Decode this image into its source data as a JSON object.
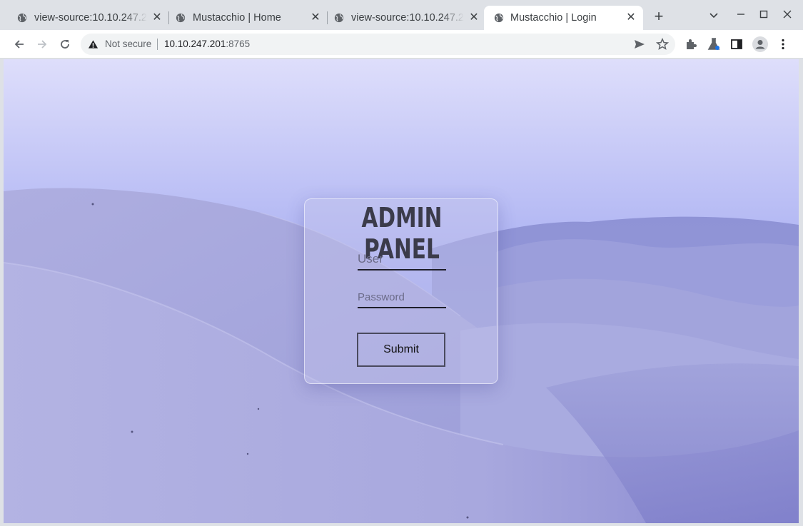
{
  "browser": {
    "tabs": [
      {
        "title": "view-source:10.10.247.2",
        "active": false
      },
      {
        "title": "Mustacchio | Home",
        "active": false
      },
      {
        "title": "view-source:10.10.247.2",
        "active": false
      },
      {
        "title": "Mustacchio | Login",
        "active": true
      }
    ],
    "new_tab_label": "+",
    "address": {
      "security_label": "Not secure",
      "host": "10.10.247.201",
      "port": ":8765"
    }
  },
  "page": {
    "heading": "ADMIN PANEL",
    "user_placeholder": "User",
    "password_placeholder": "Password",
    "submit_label": "Submit"
  },
  "colors": {
    "sky_top": "#dcdcfa",
    "sky_bottom": "#7f8ef0",
    "dune": "#a4a4dc",
    "panel_title": "#3b3b4a"
  }
}
